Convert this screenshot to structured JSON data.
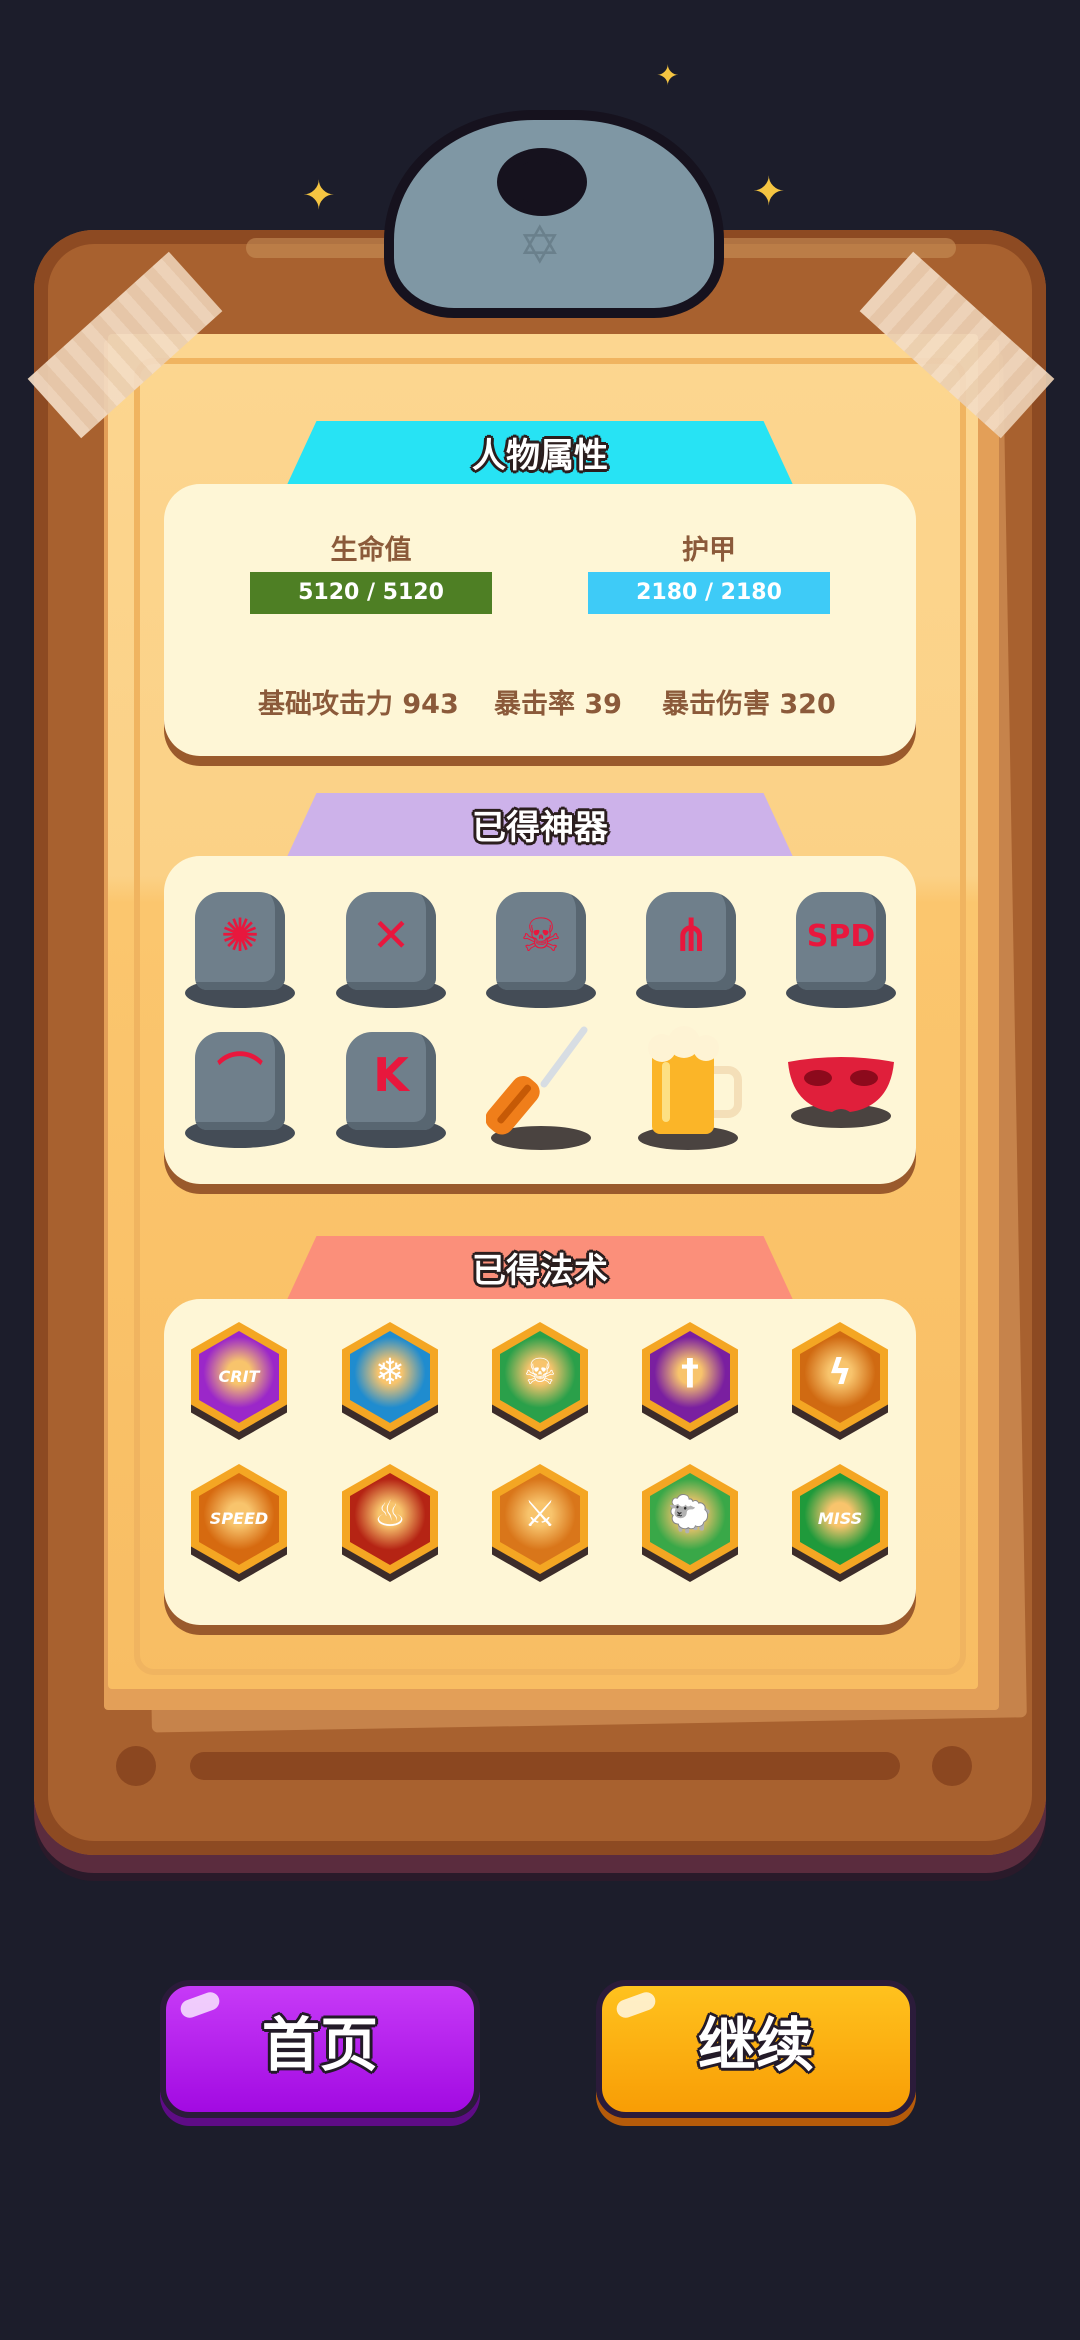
{
  "sections": {
    "attributes_title": "人物属性",
    "artifacts_title": "已得神器",
    "spells_title": "已得法术"
  },
  "attributes": {
    "hp_label": "生命值",
    "hp_value": "5120 / 5120",
    "armor_label": "护甲",
    "armor_value": "2180 / 2180",
    "base_attack": "基础攻击力 943",
    "crit_rate": "暴击率 39",
    "crit_damage": "暴击伤害 320"
  },
  "artifacts": [
    {
      "icon": "rune-stone-burst-icon",
      "glyph": "✺"
    },
    {
      "icon": "rune-stone-cross-arrows-icon",
      "glyph": "✕"
    },
    {
      "icon": "rune-stone-skull-icon",
      "glyph": "☠"
    },
    {
      "icon": "rune-stone-sunrise-icon",
      "glyph": "⋔"
    },
    {
      "icon": "rune-stone-spd-icon",
      "glyph": "SPD"
    },
    {
      "icon": "rune-stone-arc-icon",
      "glyph": "⌒"
    },
    {
      "icon": "rune-stone-k-rune-icon",
      "glyph": "K"
    },
    {
      "icon": "screwdriver-icon",
      "glyph": ""
    },
    {
      "icon": "beer-mug-icon",
      "glyph": ""
    },
    {
      "icon": "red-mask-icon",
      "glyph": ""
    }
  ],
  "spells": [
    {
      "icon": "crit-burst-spell-icon",
      "glyph": "CRIT",
      "color": "#9b27c9"
    },
    {
      "icon": "ice-shield-spell-icon",
      "glyph": "❄",
      "color": "#1f8ccf"
    },
    {
      "icon": "poison-shield-spell-icon",
      "glyph": "☠",
      "color": "#2aa04a"
    },
    {
      "icon": "sword-shield-spell-icon",
      "glyph": "†",
      "color": "#7a1fa0"
    },
    {
      "icon": "lightning-shield-spell-icon",
      "glyph": "ϟ",
      "color": "#d06a12"
    },
    {
      "icon": "speed-up-spell-icon",
      "glyph": "SPEED",
      "color": "#d66a10"
    },
    {
      "icon": "fire-shield-spell-icon",
      "glyph": "♨",
      "color": "#b52414"
    },
    {
      "icon": "crossed-swords-spell-icon",
      "glyph": "⚔",
      "color": "#d9761a"
    },
    {
      "icon": "sheep-spell-icon",
      "glyph": "🐑",
      "color": "#39a848"
    },
    {
      "icon": "miss-spell-icon",
      "glyph": "MISS",
      "color": "#1f9a3b"
    }
  ],
  "buttons": {
    "home": "首页",
    "continue": "继续"
  },
  "colors": {
    "hp_bar": "#4e7f24",
    "armor_bar": "#3ecbf7",
    "attributes_tab": "#27e3f4",
    "artifacts_tab": "#cdb2ea",
    "spells_tab": "#fb8f7a",
    "home_button": "#b719f2",
    "continue_button": "#fba807"
  }
}
